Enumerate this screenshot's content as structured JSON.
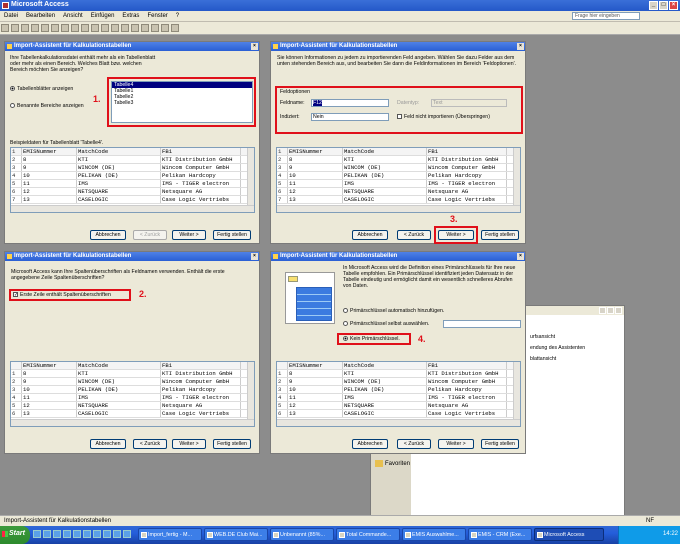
{
  "app": {
    "title": "Microsoft Access",
    "help_placeholder": "Frage hier eingeben"
  },
  "menu": [
    "Datei",
    "Bearbeiten",
    "Ansicht",
    "Einfügen",
    "Extras",
    "Fenster",
    "?"
  ],
  "grid_rows": [
    {
      "n": "1",
      "a": "EMISNummer",
      "b": "MatchCode",
      "c": "FB1"
    },
    {
      "n": "2",
      "a": "8",
      "b": "KTI",
      "c": "KTI Distribution GmbH"
    },
    {
      "n": "3",
      "a": "9",
      "b": "WINCOM (DE)",
      "c": "Wincom Computer GmbH"
    },
    {
      "n": "4",
      "a": "10",
      "b": "PELIKAN (DE)",
      "c": "Pelikan Hardcopy"
    },
    {
      "n": "5",
      "a": "11",
      "b": "IMS",
      "c": "IMS - TIGER electron"
    },
    {
      "n": "6",
      "a": "12",
      "b": "NETSQUARE",
      "c": "Netsquare AG"
    },
    {
      "n": "7",
      "a": "13",
      "b": "CASELOGIC",
      "c": "Case Logic Vertriebs"
    }
  ],
  "dialog1": {
    "title": "Import-Assistent für Kalkulationstabellen",
    "intro": "Ihre Tabellenkalkulationsdatei enthält mehr als ein Tabellenblatt oder mehr als einen Bereich. Welches Blatt bzw. welchen Bereich möchten Sie anzeigen?",
    "radio_sheets": "Tabellenblätter anzeigen",
    "radio_ranges": "Benannte Bereiche anzeigen",
    "sheets": [
      "Tabelle4",
      "Tabelle1",
      "Tabelle2",
      "Tabelle3"
    ],
    "sample_label": "Beispieldaten für Tabellenblatt 'Tabelle4'.",
    "step": "1."
  },
  "dialog2": {
    "title": "Import-Assistent für Kalkulationstabellen",
    "intro": "Sie können Informationen zu jedem zu importierenden Feld angeben. Wählen Sie dazu Felder aus dem unten stehenden Bereich aus, und bearbeiten Sie dann die Feldinformationen im Bereich 'Feldoptionen'.",
    "group": "Feldoptionen",
    "field_name_label": "Feldname:",
    "field_name_value": "F12",
    "datatype_label": "Datentyp:",
    "datatype_value": "Text",
    "indexed_label": "Indiziert:",
    "indexed_value": "Nein",
    "skip_label": "Feld nicht importieren (Überspringen)",
    "step": "3."
  },
  "dialog3": {
    "title": "Import-Assistent für Kalkulationstabellen",
    "intro": "Microsoft Access kann Ihre Spaltenüberschriften als Feldnamen verwenden. Enthält die erste angegebene Zeile Spaltenüberschriften?",
    "checkbox_label": "Erste Zeile enthält Spaltenüberschriften",
    "step": "2."
  },
  "dialog4": {
    "title": "Import-Assistent für Kalkulationstabellen",
    "intro": "In Microsoft Access wird die Definition eines Primärschlüssels für Ihre neue Tabelle empfohlen. Ein Primärschlüssel identifiziert jeden Datensatz in der Tabelle eindeutig und ermöglicht damit ein wesentlich schnelleres Abrufen von Daten.",
    "opt_auto": "Primärschlüssel automatisch hinzufügen.",
    "opt_own": "Primärschlüssel selbst auswählen.",
    "opt_none": "Kein Primärschlüssel.",
    "step": "4."
  },
  "buttons": {
    "cancel": "Abbrechen",
    "back": "< Zurück",
    "next": "Weiter >",
    "finish": "Fertig stellen"
  },
  "bg_window": {
    "items": [
      "urfsansicht",
      "endung des Assistenten",
      "blattansicht"
    ],
    "favorites": "Favoriten"
  },
  "status": {
    "left": "Import-Assistent für Kalkulationstabellen",
    "right": "NF"
  },
  "taskbar": {
    "start": "Start",
    "tasks": [
      "Import_fertig - M...",
      "WEB.DE Club Mai...",
      "Unbenannt (85%...",
      "Total Commande...",
      "EMIS Auswahlme...",
      "EMIS - CRM (Exe...",
      "Microsoft Access"
    ],
    "clock": "14:22"
  }
}
